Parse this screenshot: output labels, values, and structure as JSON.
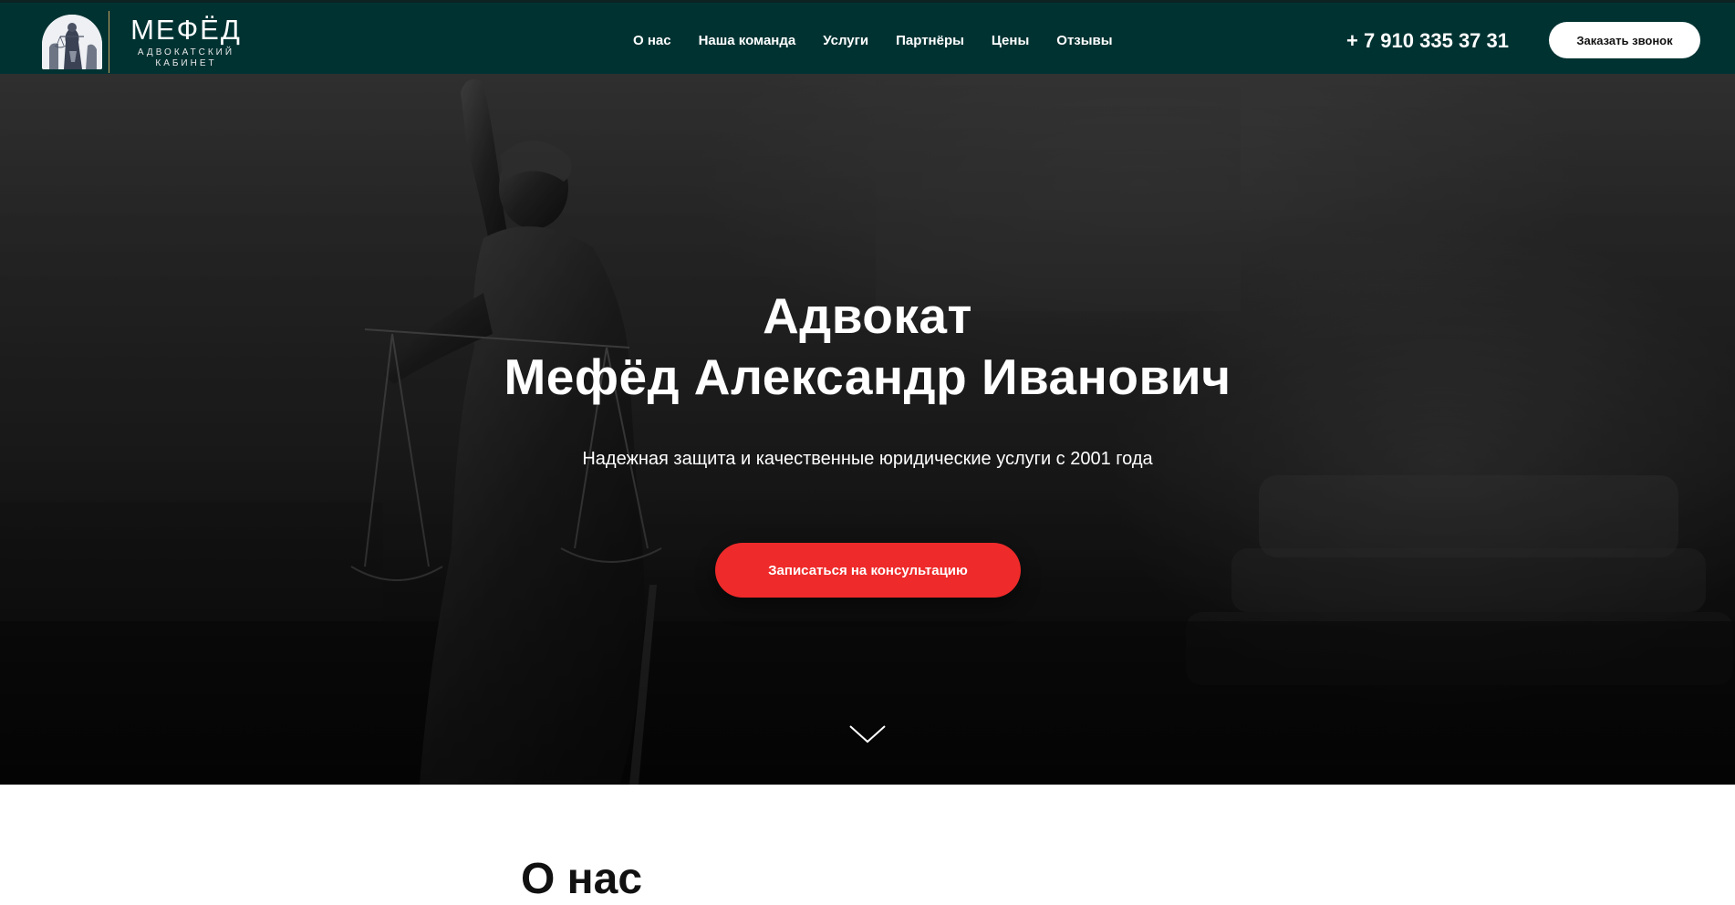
{
  "brand": {
    "name": "МЕФЁД",
    "subtitle_line1": "АДВОКАТСКИЙ",
    "subtitle_line2": "КАБИНЕТ"
  },
  "nav": {
    "items": [
      {
        "label": "О нас"
      },
      {
        "label": "Наша команда"
      },
      {
        "label": "Услуги"
      },
      {
        "label": "Партнёры"
      },
      {
        "label": "Цены"
      },
      {
        "label": "Отзывы"
      }
    ]
  },
  "header": {
    "phone": "+ 7 910 335 37 31",
    "call_button_label": "Заказать звонок"
  },
  "hero": {
    "title_line1": "Адвокат",
    "title_line2": "Мефёд Александр Иванович",
    "subtitle": "Надежная защита и качественные юридические услуги с 2001 года",
    "cta_label": "Записаться на консультацию"
  },
  "about": {
    "title": "О нас"
  },
  "colors": {
    "header_bg": "#003232",
    "accent": "#ee2a2a",
    "logo_divider": "#c9a560"
  },
  "icons": {
    "scroll": "chevron-down-icon",
    "logo": "themis-emblem-icon"
  }
}
